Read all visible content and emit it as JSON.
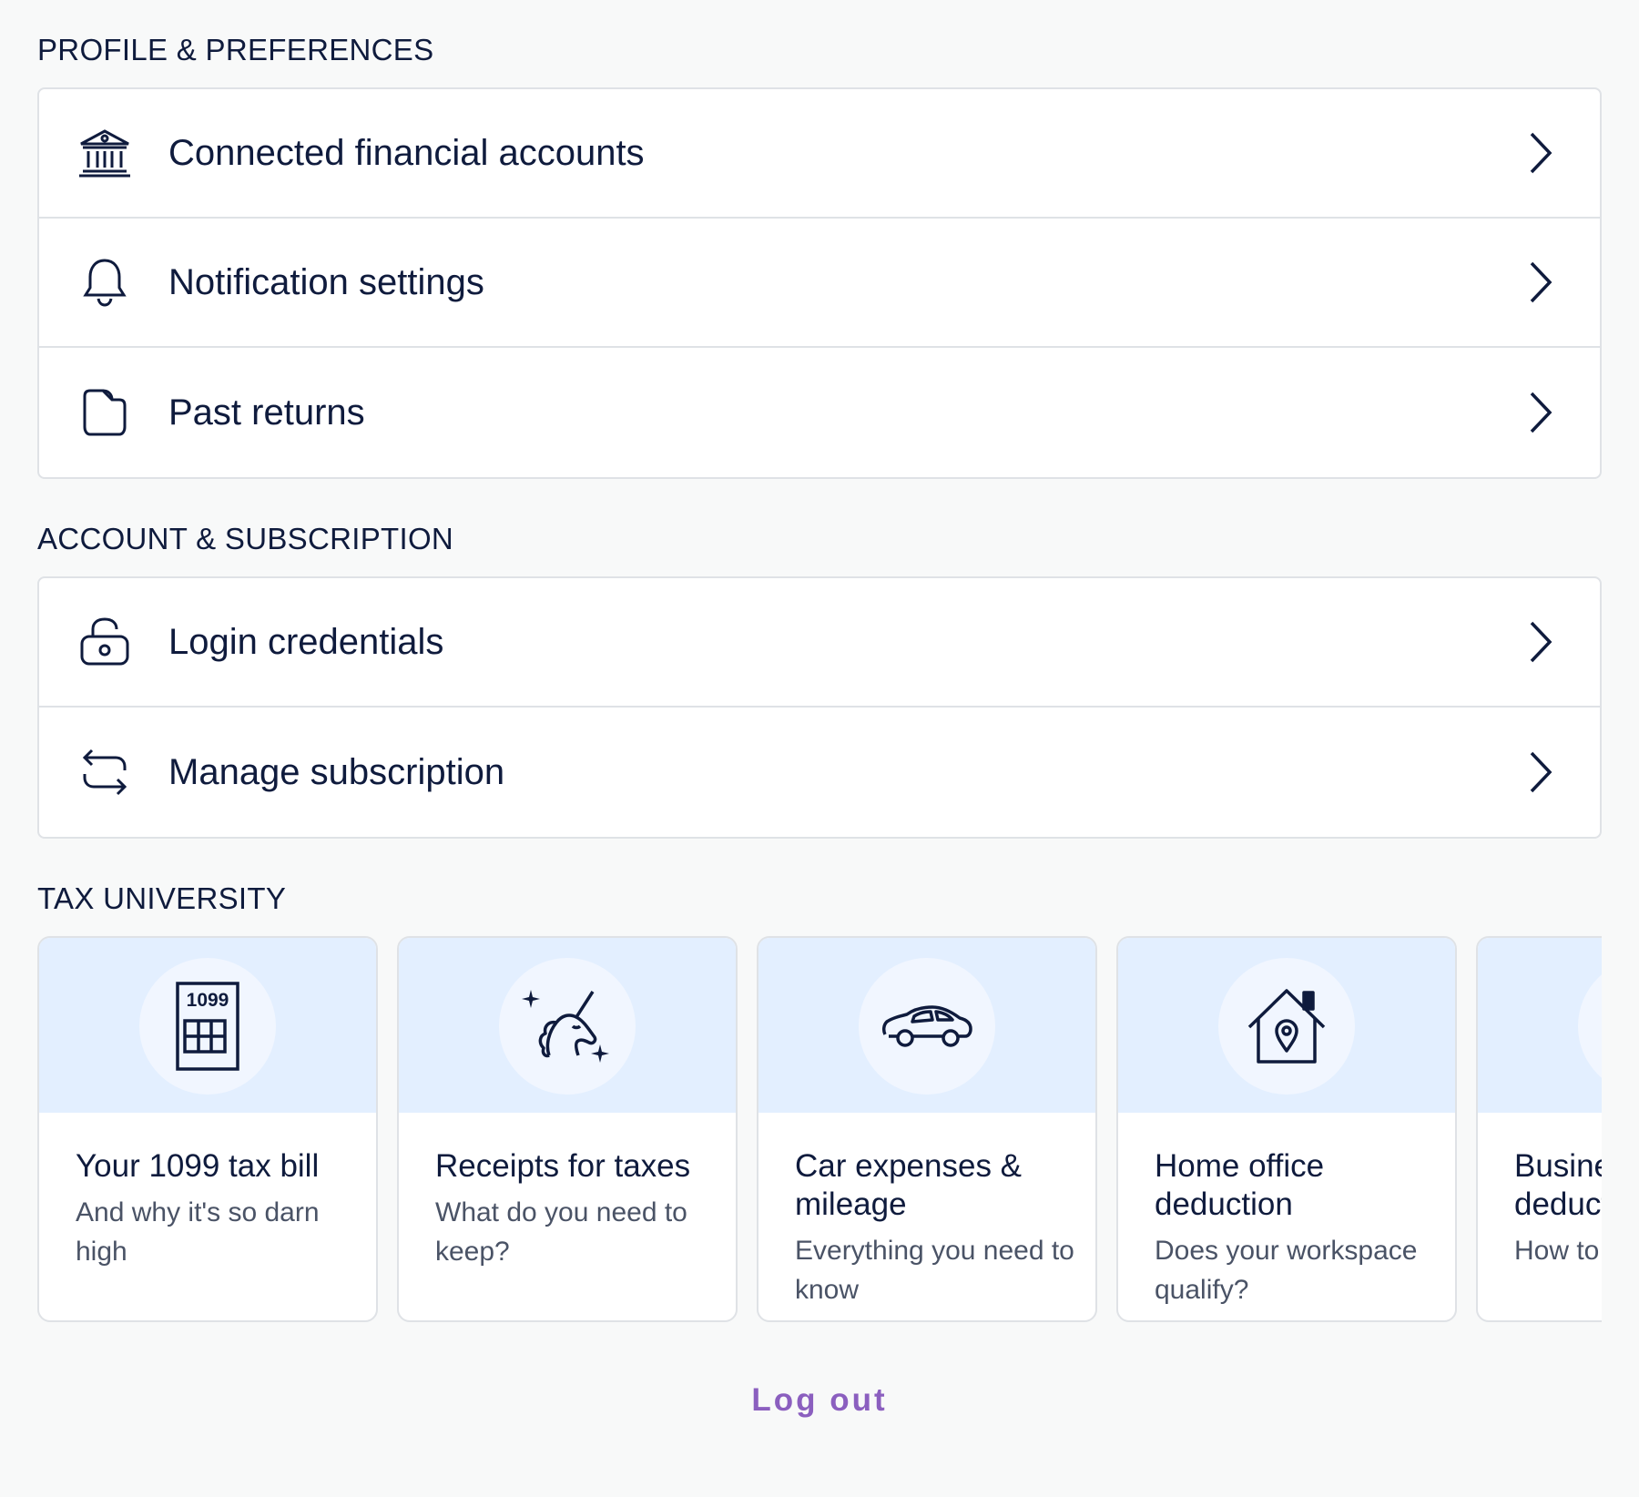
{
  "profile_section": {
    "title": "PROFILE & PREFERENCES",
    "items": [
      {
        "label": "Connected financial accounts",
        "icon": "bank-icon"
      },
      {
        "label": "Notification settings",
        "icon": "bell-icon"
      },
      {
        "label": "Past returns",
        "icon": "folder-icon"
      }
    ]
  },
  "account_section": {
    "title": "ACCOUNT & SUBSCRIPTION",
    "items": [
      {
        "label": "Login credentials",
        "icon": "unlock-icon"
      },
      {
        "label": "Manage subscription",
        "icon": "swap-arrows-icon"
      }
    ]
  },
  "tax_university": {
    "title": "TAX UNIVERSITY",
    "cards": [
      {
        "title": "Your 1099 tax bill",
        "subtitle": "And why it's so darn high",
        "icon": "form-1099-icon",
        "icon_text": "1099"
      },
      {
        "title": "Receipts for taxes",
        "subtitle": "What do you need to keep?",
        "icon": "unicorn-icon"
      },
      {
        "title": "Car expenses & mileage",
        "subtitle": "Everything you need to know",
        "icon": "car-icon"
      },
      {
        "title": "Home office deduction",
        "subtitle": "Does your workspace qualify?",
        "icon": "home-location-icon"
      },
      {
        "title": "Business trip deduction",
        "subtitle": "How to deduct a trip",
        "icon": "globe-icon"
      }
    ]
  },
  "logout": {
    "label": "Log out"
  },
  "colors": {
    "text": "#0f1b3d",
    "border": "#dfe2e6",
    "card_header": "#e3efff",
    "logout": "#8b5fbf",
    "background": "#f8f9f9"
  }
}
